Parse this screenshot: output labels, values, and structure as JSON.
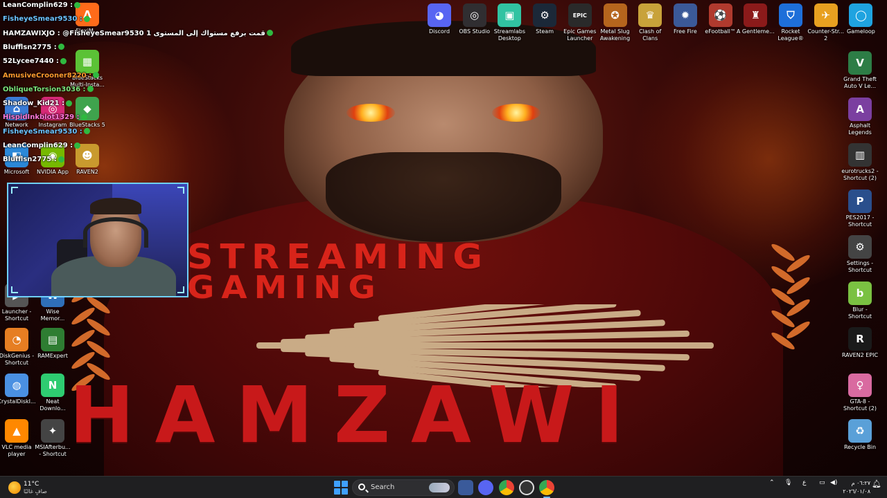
{
  "wallpaper": {
    "line1": "STREAMING",
    "line2": "GAMING",
    "name": "HAMZAWI"
  },
  "chat": [
    {
      "text": "LeanComplin629 :",
      "color": "#ffffff"
    },
    {
      "text": "FisheyeSmear9530 :",
      "color": "#6cc3ff"
    },
    {
      "text": "HAMZAWIXJO : @FisheyeSmear9530 قمت برفع مستواك إلى المستوى 1",
      "color": "#ffffff"
    },
    {
      "text": "Blufflsn2775 :",
      "color": "#ffffff"
    },
    {
      "text": "52Lycee7440 :",
      "color": "#ffffff"
    },
    {
      "text": "AmusiveCrooner8220 :",
      "color": "#ff9a2e"
    },
    {
      "text": "ObliqueTorsion3036 :",
      "color": "#7be37b"
    },
    {
      "text": "Shadow_Kid21 :",
      "color": "#ffffff"
    },
    {
      "text": "HispidInkblot1329 :",
      "color": "#ff7ad9"
    },
    {
      "text": "FisheyeSmear9530 :",
      "color": "#6cc3ff"
    },
    {
      "text": "LeanComplin629 :",
      "color": "#ffffff"
    },
    {
      "text": "Blufflsn2775 :",
      "color": "#ffffff"
    }
  ],
  "desktop_left": [
    {
      "label": "Network",
      "icon": "network-icon",
      "color": "#3a7bd5",
      "glyph": "⌂"
    },
    {
      "label": "Instagram",
      "icon": "instagram-icon",
      "color": "#d62976",
      "glyph": "◎"
    },
    {
      "label": "BlueStacks 5",
      "icon": "bluestacks-icon",
      "color": "#3fa34d",
      "glyph": "◆"
    },
    {
      "label": "BlueStacks Multi-Insta...",
      "icon": "bluestacks-multi-icon",
      "color": "#5bc236",
      "glyph": "▦"
    },
    {
      "label": "Microsoft",
      "icon": "microsoft-icon",
      "color": "#2b88d8",
      "glyph": "◧"
    },
    {
      "label": "NVIDIA App",
      "icon": "nvidia-icon",
      "color": "#76b900",
      "glyph": "◉"
    },
    {
      "label": "RAVEN2",
      "icon": "raven2-icon",
      "color": "#c99a2e",
      "glyph": "☻"
    },
    {
      "label": "Launcher - Shortcut",
      "icon": "launcher-icon",
      "color": "#555555",
      "glyph": "▶"
    },
    {
      "label": "Wise Memor...",
      "icon": "wise-memory-icon",
      "color": "#2f6fb8",
      "glyph": "W"
    },
    {
      "label": "DiskGenius - Shortcut",
      "icon": "diskgenius-icon",
      "color": "#e67e22",
      "glyph": "◔"
    },
    {
      "label": "RAMExpert",
      "icon": "ramexpert-icon",
      "color": "#2e7d32",
      "glyph": "▤"
    },
    {
      "label": "CrystalDiskI...",
      "icon": "crystaldisk-icon",
      "color": "#4a90e2",
      "glyph": "◍"
    },
    {
      "label": "Neat Downlo...",
      "icon": "neat-download-icon",
      "color": "#2ecc71",
      "glyph": "N"
    },
    {
      "label": "VLC media player",
      "icon": "vlc-icon",
      "color": "#ff8800",
      "glyph": "▲"
    },
    {
      "label": "MSIAfterbu... - Shortcut",
      "icon": "msi-afterburner-icon",
      "color": "#444444",
      "glyph": "✦"
    },
    {
      "label": "FlexiM...",
      "icon": "flexim-icon",
      "color": "#ff6b1a",
      "glyph": "Λ"
    }
  ],
  "desktop_top": [
    {
      "label": "Discord",
      "icon": "discord-icon",
      "color": "#5865f2",
      "glyph": "◕"
    },
    {
      "label": "OBS Studio",
      "icon": "obs-icon",
      "color": "#302e31",
      "glyph": "◎"
    },
    {
      "label": "Streamlabs Desktop",
      "icon": "streamlabs-icon",
      "color": "#31c3a2",
      "glyph": "▣"
    },
    {
      "label": "Steam",
      "icon": "steam-icon",
      "color": "#1b2838",
      "glyph": "⚙"
    },
    {
      "label": "Epic Games Launcher",
      "icon": "epic-games-icon",
      "color": "#2a2a2a",
      "glyph": "EPIC"
    },
    {
      "label": "Metal Slug Awakening",
      "icon": "metal-slug-icon",
      "color": "#b5651d",
      "glyph": "✪"
    },
    {
      "label": "Clash of Clans",
      "icon": "clash-of-clans-icon",
      "color": "#c8a23a",
      "glyph": "♛"
    },
    {
      "label": "Free Fire",
      "icon": "free-fire-icon",
      "color": "#3b5998",
      "glyph": "✹"
    },
    {
      "label": "eFootball™",
      "icon": "efootball-icon",
      "color": "#b03a2e",
      "glyph": "⚽"
    },
    {
      "label": "A Gentleme...",
      "icon": "gentleman-icon",
      "color": "#8b1a1a",
      "glyph": "♜"
    },
    {
      "label": "Rocket League®",
      "icon": "rocket-league-icon",
      "color": "#1e6fd9",
      "glyph": "⛉"
    },
    {
      "label": "Counter-Str... 2",
      "icon": "counter-strike-icon",
      "color": "#e8a020",
      "glyph": "✈"
    },
    {
      "label": "Gameloop",
      "icon": "gameloop-icon",
      "color": "#1fa3e0",
      "glyph": "◯"
    }
  ],
  "desktop_right": [
    {
      "label": "Grand Theft Auto V Le...",
      "icon": "gta5-icon",
      "color": "#2d7d46",
      "glyph": "V"
    },
    {
      "label": "Asphalt Legends",
      "icon": "asphalt-icon",
      "color": "#7b3fa0",
      "glyph": "A"
    },
    {
      "label": "eurotrucks2 - Shortcut (2)",
      "icon": "eurotrucks-icon",
      "color": "#333333",
      "glyph": "▥"
    },
    {
      "label": "PES2017 - Shortcut",
      "icon": "pes2017-icon",
      "color": "#2a4f8c",
      "glyph": "P"
    },
    {
      "label": "Settings - Shortcut",
      "icon": "settings-icon",
      "color": "#444444",
      "glyph": "⚙"
    },
    {
      "label": "Blur - Shortcut",
      "icon": "blur-icon",
      "color": "#7ac142",
      "glyph": "b"
    },
    {
      "label": "RAVEN2 EPIC",
      "icon": "raven2-epic-icon",
      "color": "#1a1a1a",
      "glyph": "R"
    },
    {
      "label": "GTA-8 - Shortcut (2)",
      "icon": "gta8-icon",
      "color": "#d96aa0",
      "glyph": "♀"
    },
    {
      "label": "Recycle Bin",
      "icon": "recycle-bin-icon",
      "color": "#5aa0d8",
      "glyph": "♻"
    }
  ],
  "taskbar": {
    "weather_temp": "11°C",
    "weather_cond": "صافٍ غالبًا",
    "search_label": "Search",
    "lang": "ع",
    "time": "٠٦:٢٧ م",
    "date": "٢٠٢٦/٠١/٠٨"
  }
}
